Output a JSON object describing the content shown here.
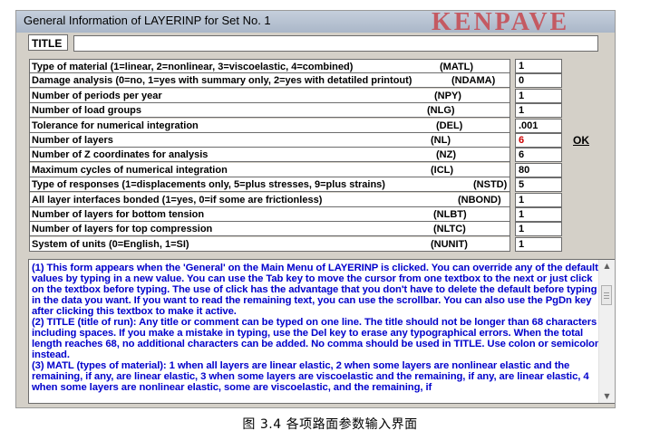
{
  "window": {
    "title": "General Information of LAYERINP for Set No.  1",
    "logo_text": "KENPAVE"
  },
  "title_field": {
    "label": "TITLE",
    "value": ""
  },
  "parameters": [
    {
      "label": "Type of material (1=linear, 2=nonlinear, 3=viscoelastic, 4=combined)",
      "code": "(MATL)",
      "value": "1"
    },
    {
      "label": "Damage analysis (0=no, 1=yes with summary only, 2=yes with detatiled printout)",
      "code": "(NDAMA)",
      "value": "0"
    },
    {
      "label": "Number of periods per year",
      "code": "(NPY)",
      "value": "1"
    },
    {
      "label": "Number of load groups",
      "code": "(NLG)",
      "value": "1"
    },
    {
      "label": "Tolerance for numerical integration",
      "code": "(DEL)",
      "value": ".001"
    },
    {
      "label": "Number of layers",
      "code": "(NL)",
      "value": "6"
    },
    {
      "label": "Number of Z coordinates for analysis",
      "code": "(NZ)",
      "value": "6"
    },
    {
      "label": "Maximum cycles of numerical integration",
      "code": "(ICL)",
      "value": "80"
    },
    {
      "label": "Type of responses (1=displacements only, 5=plus stresses, 9=plus strains)",
      "code": "(NSTD)",
      "value": "5"
    },
    {
      "label": "All layer interfaces bonded (1=yes, 0=if some are frictionless)",
      "code": "(NBOND)",
      "value": "1"
    },
    {
      "label": "Number of layers for bottom tension",
      "code": "(NLBT)",
      "value": "1"
    },
    {
      "label": "Number of layers for top compression",
      "code": "(NLTC)",
      "value": "1"
    },
    {
      "label": "System of units (0=English, 1=SI)",
      "code": "(NUNIT)",
      "value": "1"
    }
  ],
  "ok_button": {
    "label": "OK"
  },
  "help": {
    "text": "    (1)  This form appears when the 'General' on the Main Menu of LAYERINP is clicked.  You can override any of the default values by typing in a new value.  You can use the Tab key to move the cursor from one textbox to the next or just click on the textbox before typing.  The use of click has the advantage that you don't have to delete the default before typing in the data you want.  If you want to read the remaining text, you can use the scrollbar.  You can also use the PgDn key after clicking this textbox to make it active.\n    (2)  TITLE (title of run): Any title or comment can be typed on one line.  The title should not be longer than 68 characters including spaces.  If you make a mistake in typing, use the Del key to erase any typographical errors.  When the total length reaches 68, no additional characters can be added.  No comma should be used in TITLE.  Use colon or semicolon instead.\n    (3)  MATL (types of material): 1 when all layers are linear elastic, 2 when some layers are nonlinear elastic and the remaining, if any, are linear elastic, 3 when some layers are viscoelastic and the remaining, if any, are linear elastic, 4 when some layers are nonlinear elastic, some are viscoelastic, and the remaining, if"
  },
  "caption": "图 3.4  各项路面参数输入界面",
  "colors": {
    "window_bg": "#d4d0c8",
    "help_text": "#0000cc",
    "highlight_value": "#cc0000"
  }
}
